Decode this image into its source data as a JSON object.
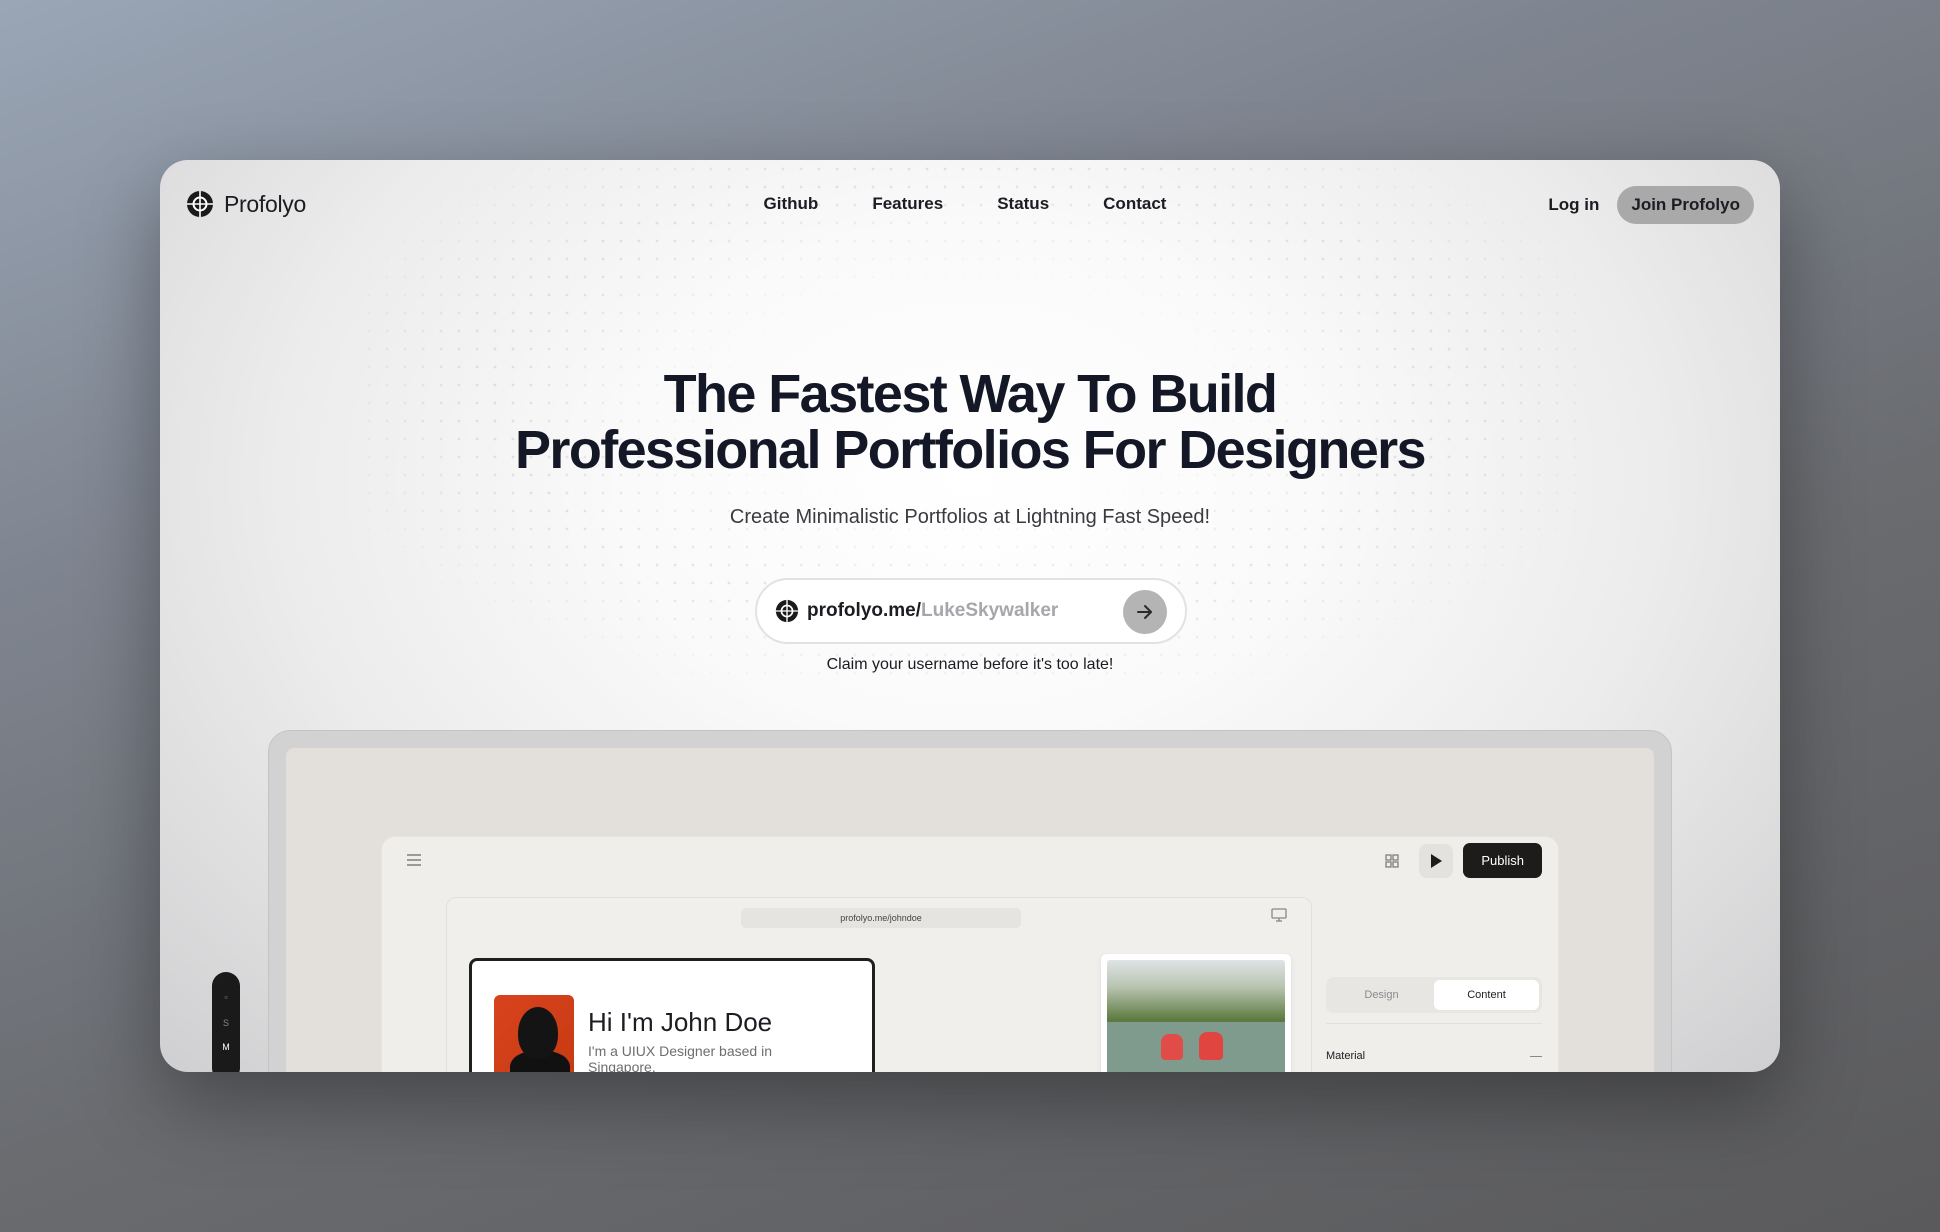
{
  "brand": {
    "name": "Profolyo"
  },
  "nav": {
    "links": [
      "Github",
      "Features",
      "Status",
      "Contact"
    ],
    "login_label": "Log in",
    "join_label": "Join Profolyo"
  },
  "hero": {
    "title_line1": "The Fastest Way To Build",
    "title_line2": "Professional Portfolios For Designers",
    "subtitle": "Create Minimalistic Portfolios at Lightning Fast Speed!"
  },
  "claim": {
    "prefix": "profolyo.me/",
    "placeholder": "LukeSkywalker",
    "note": "Claim your username before it's too late!"
  },
  "preview": {
    "publish_label": "Publish",
    "url": "profolyo.me/johndoe",
    "side_items": [
      "S",
      "M"
    ],
    "card_name": "Hi I'm John Doe",
    "card_bio": "I'm a UIUX Designer based in Singapore.",
    "tabs": [
      {
        "label": "Design",
        "active": false
      },
      {
        "label": "Content",
        "active": true
      }
    ],
    "panel_section": "Material"
  },
  "colors": {
    "accent_dark": "#1e1c1b",
    "portrait_orange": "#d8431c"
  }
}
